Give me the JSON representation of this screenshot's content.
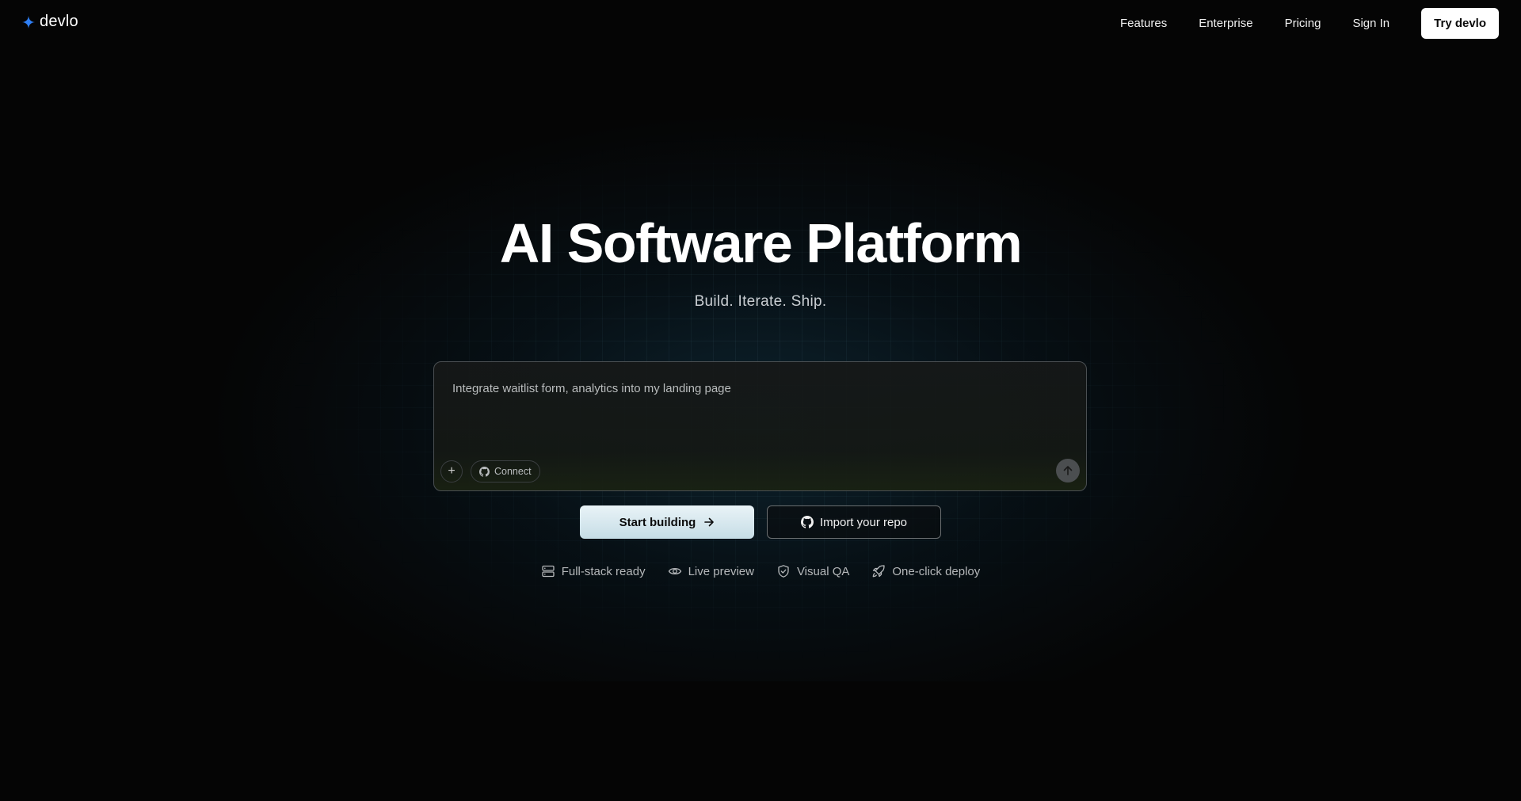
{
  "nav": {
    "logo_text": "devlo",
    "links": [
      "Features",
      "Enterprise",
      "Pricing",
      "Sign In"
    ],
    "cta_label": "Try devlo"
  },
  "hero": {
    "title": "AI Software Platform",
    "subtitle": "Build. Iterate. Ship."
  },
  "prompt": {
    "placeholder": "Integrate waitlist form, analytics into my landing page",
    "plus_label": "+",
    "connect_label": "Connect"
  },
  "actions": {
    "primary_label": "Start building",
    "secondary_label": "Import your repo"
  },
  "features": [
    {
      "label": "Full-stack ready",
      "icon": "server-icon"
    },
    {
      "label": "Live preview",
      "icon": "eye-icon"
    },
    {
      "label": "Visual QA",
      "icon": "shield-check-icon"
    },
    {
      "label": "One-click deploy",
      "icon": "rocket-icon"
    }
  ],
  "colors": {
    "background": "#050505",
    "logo_accent": "#2f7ff5",
    "primary_button": "#d8e9f0",
    "send_button": "#4b4e50"
  }
}
